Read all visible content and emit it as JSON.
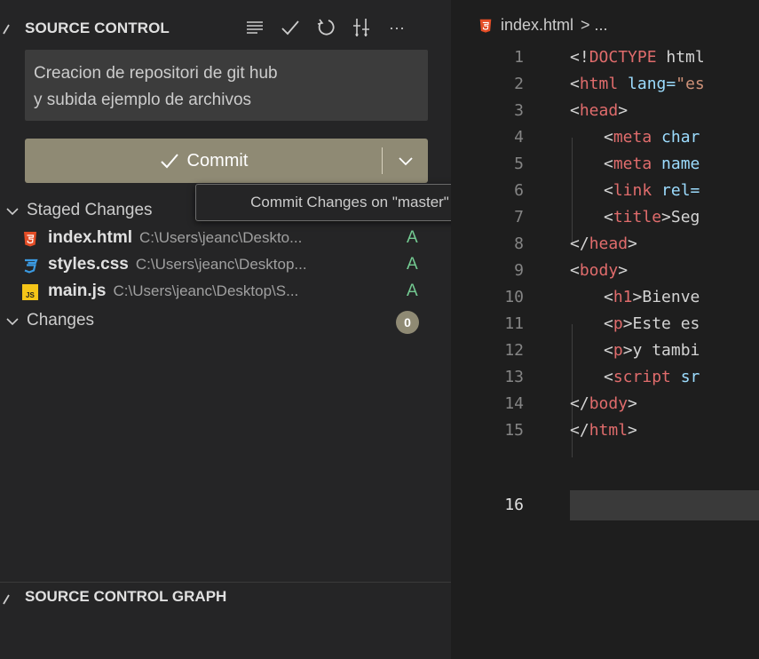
{
  "source_control": {
    "title": "SOURCE CONTROL",
    "actions": [
      "view-as-tree-icon",
      "commit-check-icon",
      "refresh-icon",
      "graph-filter-icon",
      "more-actions-icon"
    ],
    "more_label": "···",
    "commit_message": "Creacion de repositori de git hub\ny subida ejemplo de archivos",
    "commit_button_label": "Commit",
    "tooltip": "Commit Changes on \"master\"",
    "staged_changes": {
      "label": "Staged Changes",
      "files": [
        {
          "icon": "html5-icon",
          "name": "index.html",
          "path": "C:\\Users\\jeanc\\Deskto...",
          "status": "A"
        },
        {
          "icon": "css3-icon",
          "name": "styles.css",
          "path": "C:\\Users\\jeanc\\Desktop...",
          "status": "A"
        },
        {
          "icon": "javascript-icon",
          "name": "main.js",
          "path": "C:\\Users\\jeanc\\Desktop\\S...",
          "status": "A"
        }
      ]
    },
    "changes": {
      "label": "Changes",
      "count": "0"
    },
    "graph_title": "SOURCE CONTROL GRAPH"
  },
  "editor": {
    "breadcrumb_file": "index.html",
    "breadcrumb_rest": ">  ...",
    "lines": [
      "1",
      "2",
      "3",
      "4",
      "5",
      "6",
      "7",
      "8",
      "9",
      "10",
      "11",
      "12",
      "13",
      "14",
      "15",
      "16"
    ],
    "code": {
      "l1_open": "<!",
      "l1_doctype": "DOCTYPE",
      "l1_rest": " html",
      "l2_open": "<",
      "l2_tag": "html",
      "l2_attr": " lang=",
      "l2_str": "\"es",
      "l3": "head",
      "l4_tag": "meta",
      "l4_rest": " char",
      "l5_tag": "meta",
      "l5_rest": " name",
      "l6_tag": "link",
      "l6_rest": " rel=",
      "l7_tag": "title",
      "l7_rest": "Seg",
      "l8": "head",
      "l9": "body",
      "l10_tag": "h1",
      "l10_rest": "Bienve",
      "l11_tag": "p",
      "l11_rest": "Este es",
      "l12_tag": "p",
      "l12_rest": "y tambi",
      "l13_tag": "script",
      "l13_rest": " sr",
      "l14": "body",
      "l15": "html"
    }
  },
  "colors": {
    "accent_button": "#8f8a74",
    "added_status": "#73c991",
    "tag": "#e06c6c"
  }
}
